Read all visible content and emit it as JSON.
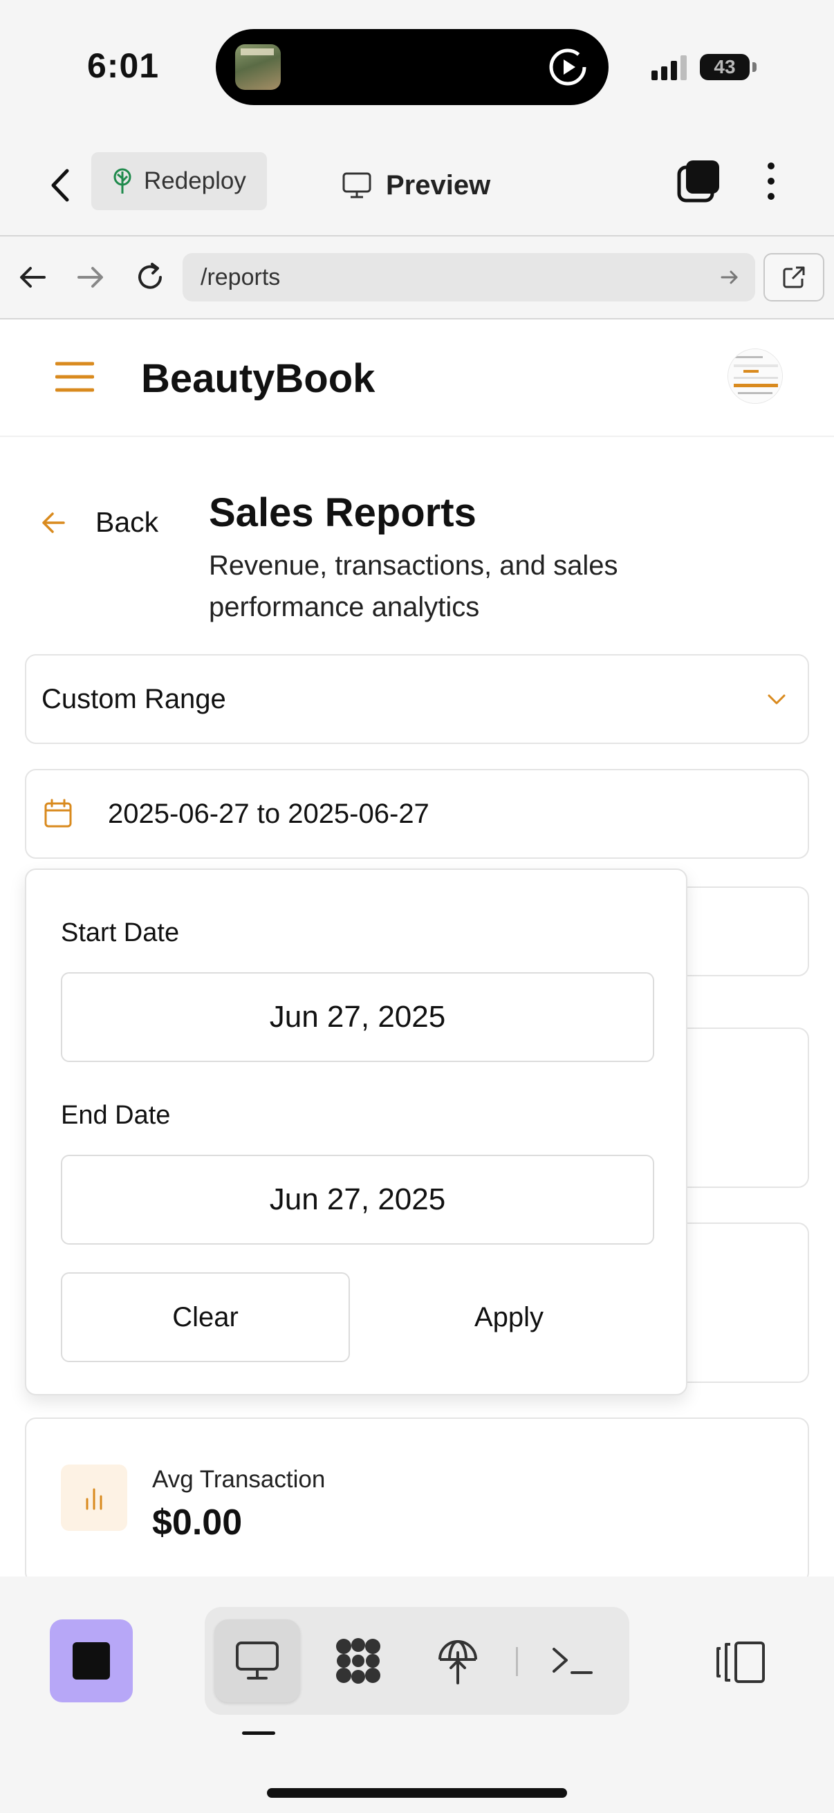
{
  "status_bar": {
    "time": "6:01",
    "battery": "43"
  },
  "app_toolbar": {
    "redeploy_label": "Redeploy",
    "preview_label": "Preview"
  },
  "url_bar": {
    "url": "/reports"
  },
  "header": {
    "brand": "BeautyBook"
  },
  "page": {
    "back_label": "Back",
    "title": "Sales Reports",
    "subtitle": "Revenue, transactions, and sales performance analytics"
  },
  "filters": {
    "range_selected": "Custom Range",
    "date_range_display": "2025-06-27 to 2025-06-27"
  },
  "date_popover": {
    "start_label": "Start Date",
    "start_value": "Jun 27, 2025",
    "end_label": "End Date",
    "end_value": "Jun 27, 2025",
    "clear_label": "Clear",
    "apply_label": "Apply"
  },
  "stats": [
    {
      "label": "Avg Transaction",
      "value": "$0.00",
      "icon": "bar-chart-icon"
    }
  ],
  "colors": {
    "accent": "#d98a1e",
    "stop_button": "#b7a7f7",
    "redeploy_icon": "#1f8a4c"
  },
  "dock": {
    "items": [
      "desktop-icon",
      "graph-icon",
      "deploy-icon",
      "terminal-icon"
    ],
    "active": "desktop-icon"
  }
}
